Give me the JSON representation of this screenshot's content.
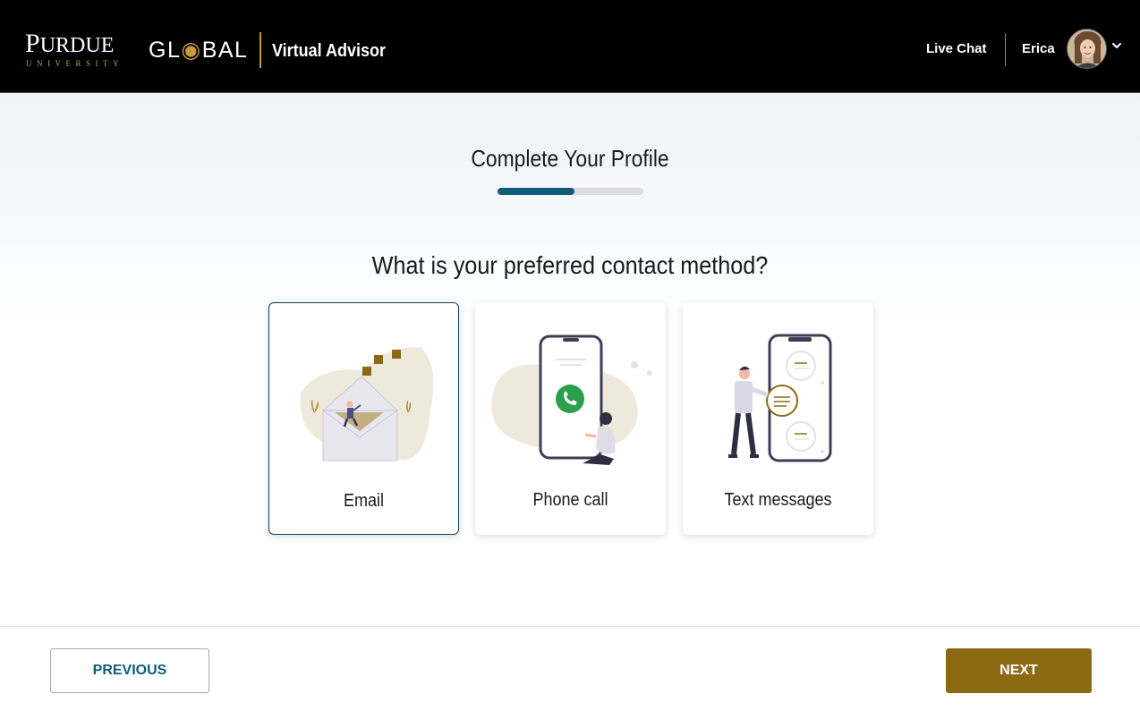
{
  "header": {
    "logo": {
      "brand": "PURDUE",
      "sub": "UNIVERSITY",
      "global": "GLOBAL"
    },
    "app_name": "Virtual Advisor",
    "live_chat_label": "Live Chat",
    "user_name": "Erica",
    "avatar_icon": "user-avatar-photo",
    "menu_icon": "chevron-down-icon"
  },
  "profile": {
    "title": "Complete Your Profile",
    "progress_fraction": 0.53
  },
  "question": "What is your preferred contact method?",
  "options": [
    {
      "label": "Email",
      "icon": "email-envelope-illustration",
      "selected": true
    },
    {
      "label": "Phone call",
      "icon": "phone-call-illustration",
      "selected": false
    },
    {
      "label": "Text messages",
      "icon": "text-messages-illustration",
      "selected": false
    }
  ],
  "footer": {
    "previous_label": "PREVIOUS",
    "next_label": "NEXT"
  },
  "colors": {
    "brand_gold": "#8c6a12",
    "accent_teal": "#0e5e7a",
    "selected_border": "#0e3d5c"
  }
}
